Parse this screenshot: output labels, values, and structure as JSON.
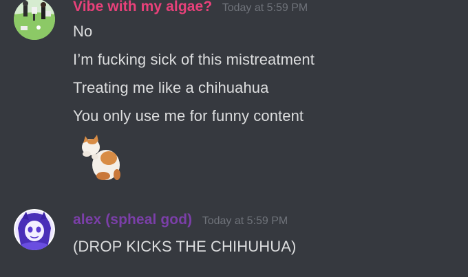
{
  "messages": [
    {
      "username": "Vibe with my algae?",
      "username_color": "#e8417a",
      "timestamp": "Today at 5:59 PM",
      "lines": [
        "No",
        "I’m fucking sick of this mistreatment",
        "Treating me like a chihuahua",
        "You only use me for funny content"
      ],
      "attachment": "kitten-image"
    },
    {
      "username": "alex (spheal god)",
      "username_color": "#7b3fa8",
      "timestamp": "Today at 5:59 PM",
      "lines": [
        "(DROP KICKS THE CHIHUHUA)"
      ]
    }
  ]
}
